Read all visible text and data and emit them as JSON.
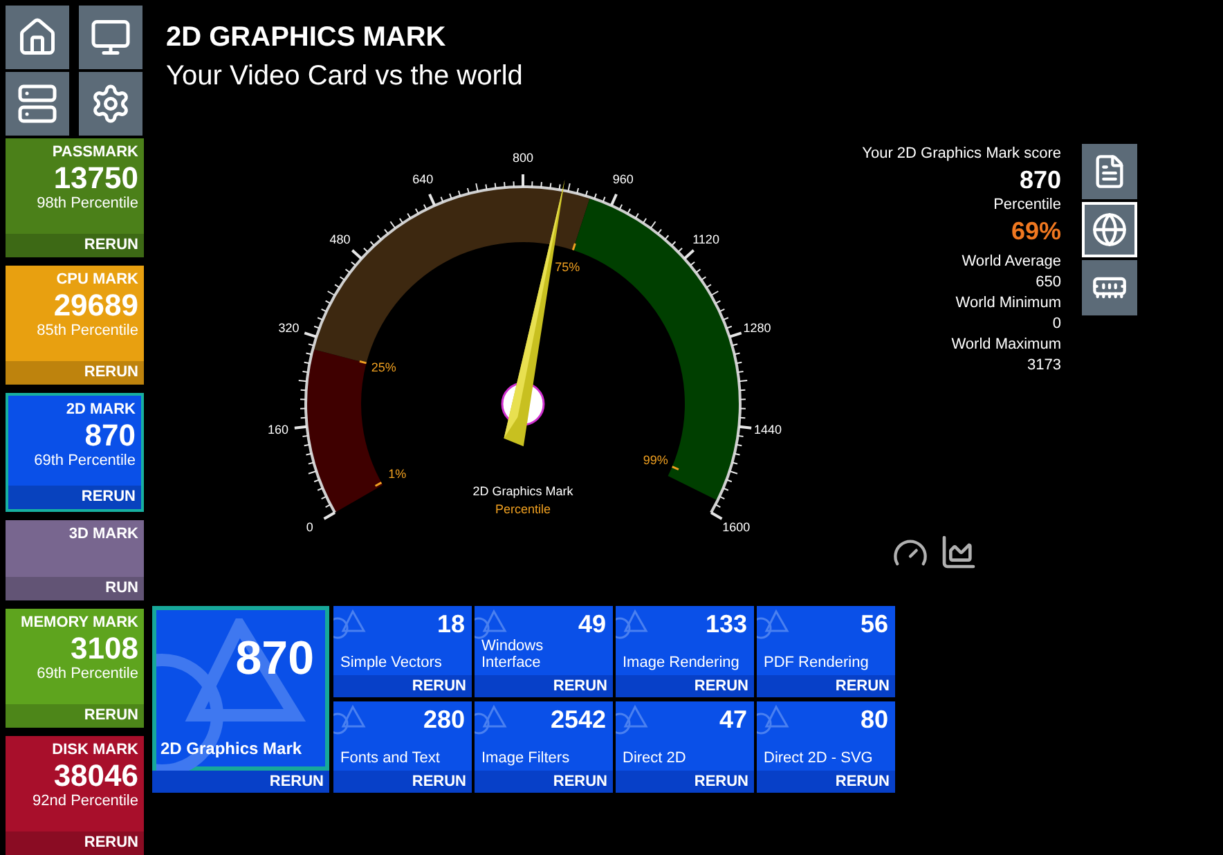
{
  "sidebar": {
    "marks": [
      {
        "title": "PASSMARK",
        "score": "13750",
        "percentile": "98th Percentile",
        "action": "RERUN",
        "color": "#4b8019",
        "selected": false
      },
      {
        "title": "CPU MARK",
        "score": "29689",
        "percentile": "85th Percentile",
        "action": "RERUN",
        "color": "#e8a010",
        "selected": false
      },
      {
        "title": "2D MARK",
        "score": "870",
        "percentile": "69th Percentile",
        "action": "RERUN",
        "color": "#0a50e8",
        "selected": true
      },
      {
        "title": "3D MARK",
        "action": "RUN",
        "color": "#78668f",
        "selected": false
      },
      {
        "title": "MEMORY MARK",
        "score": "3108",
        "percentile": "69th Percentile",
        "action": "RERUN",
        "color": "#5ea41e",
        "selected": false
      },
      {
        "title": "DISK MARK",
        "score": "38046",
        "percentile": "92nd Percentile",
        "action": "RERUN",
        "color": "#a80f2b",
        "selected": false
      }
    ]
  },
  "header": {
    "title": "2D GRAPHICS MARK",
    "subtitle": "Your Video Card vs the world"
  },
  "gauge": {
    "tick_labels": [
      "0",
      "160",
      "320",
      "480",
      "640",
      "800",
      "960",
      "1120",
      "1280",
      "1440",
      "1600"
    ],
    "markers": [
      {
        "label": "1%"
      },
      {
        "label": "25%"
      },
      {
        "label": "75%"
      },
      {
        "label": "99%"
      }
    ],
    "caption": "2D Graphics Mark",
    "subcaption": "Percentile",
    "level": 0.544
  },
  "score_panel": {
    "label": "Your 2D Graphics Mark score",
    "score": "870",
    "percentile_label": "Percentile",
    "percentile": "69%",
    "stats": [
      {
        "label": "World Average",
        "value": "650"
      },
      {
        "label": "World Minimum",
        "value": "0"
      },
      {
        "label": "World Maximum",
        "value": "3173"
      }
    ],
    "side_buttons": [
      {
        "kind": "report",
        "selected": false
      },
      {
        "kind": "world",
        "selected": true
      },
      {
        "kind": "card",
        "selected": false
      }
    ]
  },
  "tests": {
    "main": {
      "score": "870",
      "label": "2D Graphics Mark",
      "action": "RERUN",
      "selected": true
    },
    "subtests": [
      {
        "score": "18",
        "label": "Simple Vectors",
        "action": "RERUN"
      },
      {
        "score": "49",
        "label": "Windows Interface",
        "action": "RERUN"
      },
      {
        "score": "133",
        "label": "Image Rendering",
        "action": "RERUN"
      },
      {
        "score": "56",
        "label": "PDF Rendering",
        "action": "RERUN"
      },
      {
        "score": "280",
        "label": "Fonts and Text",
        "action": "RERUN"
      },
      {
        "score": "2542",
        "label": "Image Filters",
        "action": "RERUN"
      },
      {
        "score": "47",
        "label": "Direct 2D",
        "action": "RERUN"
      },
      {
        "score": "80",
        "label": "Direct 2D - SVG",
        "action": "RERUN"
      }
    ]
  }
}
